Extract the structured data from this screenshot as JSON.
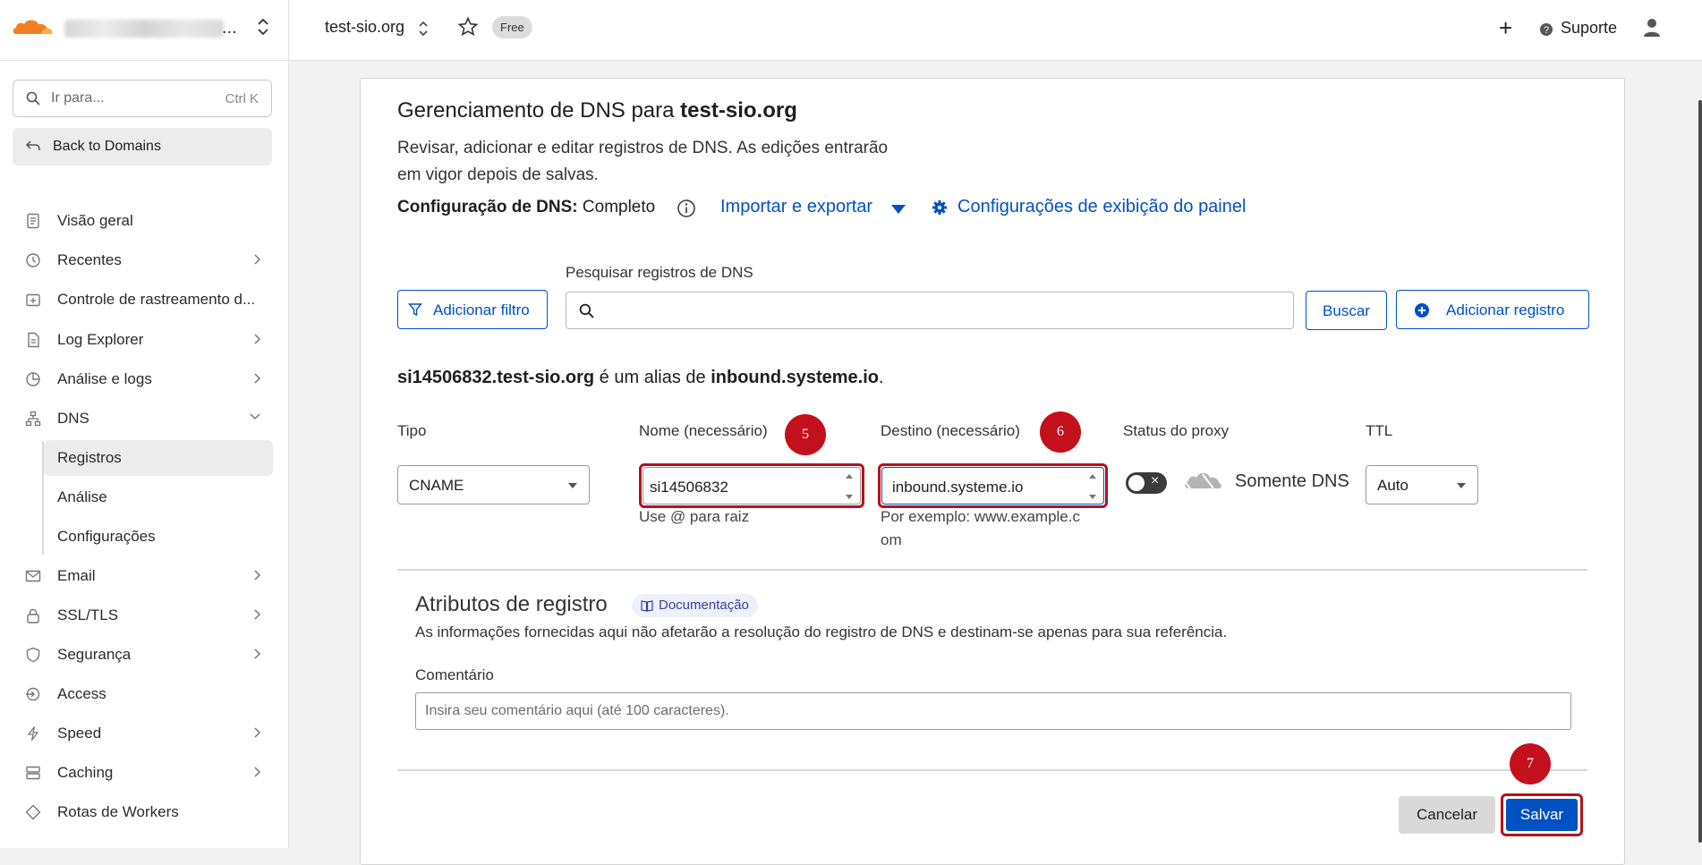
{
  "sidebar": {
    "goto_placeholder": "Ir para...",
    "goto_shortcut": "Ctrl K",
    "back_label": "Back to Domains",
    "items": [
      {
        "label": "Visão geral"
      },
      {
        "label": "Recentes"
      },
      {
        "label": "Controle de rastreamento d..."
      },
      {
        "label": "Log Explorer"
      },
      {
        "label": "Análise e logs"
      },
      {
        "label": "DNS"
      },
      {
        "label": "Email"
      },
      {
        "label": "SSL/TLS"
      },
      {
        "label": "Segurança"
      },
      {
        "label": "Access"
      },
      {
        "label": "Speed"
      },
      {
        "label": "Caching"
      },
      {
        "label": "Rotas de Workers"
      }
    ],
    "dns_sub": [
      {
        "label": "Registros"
      },
      {
        "label": "Análise"
      },
      {
        "label": "Configurações"
      }
    ]
  },
  "topbar": {
    "zone": "test-sio.org",
    "plan": "Free",
    "support": "Suporte"
  },
  "main": {
    "title_prefix": "Gerenciamento de DNS para ",
    "title_domain": "test-sio.org",
    "description": "Revisar, adicionar e editar registros de DNS. As edições entrarão em vigor depois de salvas.",
    "config_label": "Configuração de DNS:",
    "config_value": "Completo",
    "import_export": "Importar e exportar",
    "dashboard_settings": "Configurações de exibição do painel",
    "add_filter": "Adicionar filtro",
    "search_label": "Pesquisar registros de DNS",
    "search_button": "Buscar",
    "add_record": "Adicionar registro",
    "alias_name": "si14506832.test-sio.org",
    "alias_mid": " é um alias de ",
    "alias_target": "inbound.systeme.io",
    "alias_end": "."
  },
  "form": {
    "type_label": "Tipo",
    "type_value": "CNAME",
    "name_label": "Nome (necessário)",
    "name_value": "si14506832",
    "name_hint": "Use @ para raiz",
    "target_label": "Destino (necessário)",
    "target_value": "inbound.systeme.io",
    "target_hint_1": "Por exemplo: www.example.c",
    "target_hint_2": "om",
    "proxy_label": "Status do proxy",
    "proxy_value": "Somente DNS",
    "ttl_label": "TTL",
    "ttl_value": "Auto",
    "markers": [
      "5",
      "6",
      "7"
    ]
  },
  "attributes": {
    "title": "Atributos de registro",
    "doc_badge": "Documentação",
    "description": "As informações fornecidas aqui não afetarão a resolução do registro de DNS e destinam-se apenas para sua referência.",
    "comment_label": "Comentário",
    "comment_placeholder": "Insira seu comentário aqui (até 100 caracteres).",
    "cancel": "Cancelar",
    "save": "Salvar"
  },
  "colors": {
    "accent": "#0051c3",
    "marker": "#c2101c",
    "brand_orange": "#f38020"
  }
}
